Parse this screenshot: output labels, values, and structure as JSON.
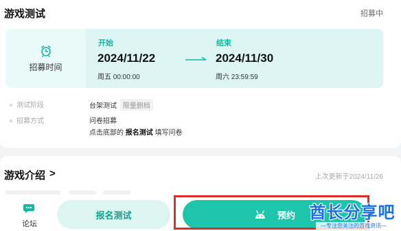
{
  "test_card": {
    "title": "游戏测试",
    "status": "招募中",
    "recruit_label": "招募时间",
    "start": {
      "label": "开始",
      "date": "2024/11/22",
      "time": "周五 00:00:00"
    },
    "end": {
      "label": "结束",
      "date": "2024/11/30",
      "time": "周六 23:59:59"
    },
    "stage_label": "测试阶段",
    "stage_value": "台架测试",
    "stage_tag": "限量删档",
    "method_label": "招募方式",
    "method_value": "问卷招募",
    "method_desc_prefix": "点击底部的",
    "method_desc_bold": "报名测试",
    "method_desc_suffix": "填写问卷"
  },
  "intro": {
    "title": "游戏介绍",
    "chevron": ">",
    "updated": "上次更新于2024/11/26"
  },
  "bottom_bar": {
    "forum_label": "论坛",
    "signup_label": "报名测试",
    "reserve_label": "预约"
  },
  "watermark": {
    "text": "酋长分享吧",
    "sub": "—专注您关注的游戏资讯—"
  },
  "colors": {
    "accent": "#1ec5ad",
    "accent_text": "#12b8a0",
    "highlight": "#d9302c",
    "watermark": "#1e6fe0"
  },
  "icons": [
    "alarm-icon",
    "arrow-right-icon",
    "forum-icon",
    "android-icon"
  ]
}
